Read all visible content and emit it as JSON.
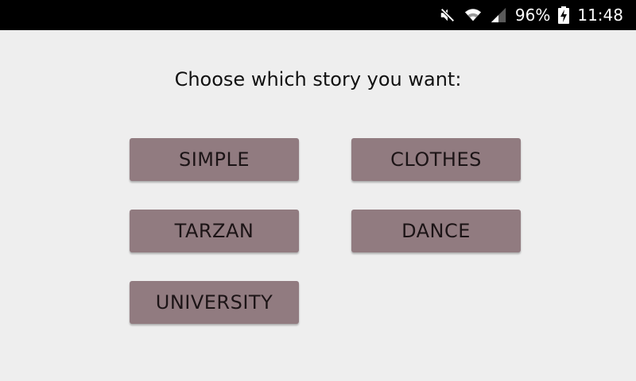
{
  "status_bar": {
    "icons": [
      "mute-icon",
      "wifi-icon",
      "cell-signal-icon",
      "battery-charging-icon"
    ],
    "battery": "96%",
    "time": "11:48"
  },
  "prompt": "Choose which story you want:",
  "buttons": {
    "simple": "SIMPLE",
    "clothes": "CLOTHES",
    "tarzan": "TARZAN",
    "dance": "DANCE",
    "university": "UNIVERSITY"
  },
  "colors": {
    "background": "#eeeeee",
    "status_bar": "#000000",
    "button": "#917b80",
    "button_text": "#1c1416"
  }
}
